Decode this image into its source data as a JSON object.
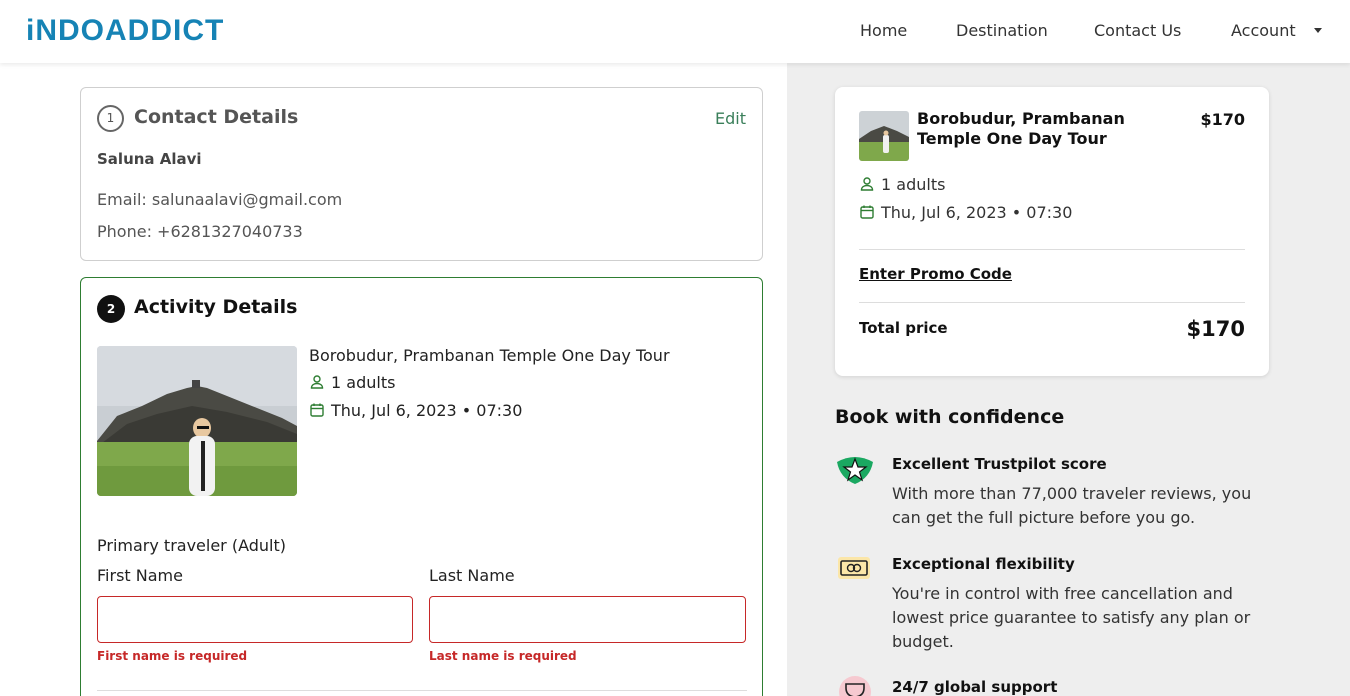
{
  "header": {
    "logo": "iNDOADDICT",
    "nav": {
      "home": "Home",
      "destination": "Destination",
      "contact": "Contact Us",
      "account": "Account"
    }
  },
  "contact": {
    "step": "1",
    "title": "Contact Details",
    "edit": "Edit",
    "name": "Saluna Alavi",
    "email": "Email: salunaalavi@gmail.com",
    "phone": "Phone: +6281327040733"
  },
  "activity": {
    "step": "2",
    "title": "Activity Details",
    "tour_name": "Borobudur, Prambanan Temple One Day Tour",
    "adults": "1 adults",
    "date": "Thu, Jul 6, 2023 • 07:30",
    "primary_traveler": "Primary traveler (Adult)",
    "first_name_label": "First Name",
    "last_name_label": "Last Name",
    "first_name_value": "",
    "last_name_value": "",
    "first_name_error": "First name is required",
    "last_name_error": "Last name is required"
  },
  "summary": {
    "tour_name": "Borobudur, Prambanan Temple One Day Tour",
    "price": "$170",
    "adults": "1 adults",
    "date": "Thu, Jul 6, 2023 • 07:30",
    "promo": "Enter Promo Code",
    "total_label": "Total price",
    "total": "$170"
  },
  "confidence": {
    "title": "Book with confidence",
    "items": [
      {
        "icon": "trustpilot-star-icon",
        "heading": "Excellent Trustpilot score",
        "text": "With more than 77,000 traveler reviews, you can get the full picture before you go."
      },
      {
        "icon": "money-icon",
        "heading": "Exceptional flexibility",
        "text": "You're in control with free cancellation and lowest price guarantee to satisfy any plan or budget."
      },
      {
        "icon": "trophy-icon",
        "heading": "24/7 global support",
        "text": ""
      }
    ]
  },
  "colors": {
    "brand": "#1683b5",
    "accent_green": "#2e7d32",
    "error": "#c62828"
  }
}
